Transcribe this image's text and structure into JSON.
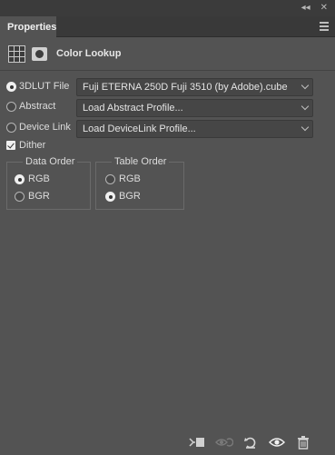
{
  "window": {
    "collapse_glyph": "◂◂",
    "close_glyph": "✕"
  },
  "panel": {
    "tab_label": "Properties",
    "adjustment_title": "Color Lookup"
  },
  "lookup": {
    "options": [
      {
        "label": "3DLUT File",
        "selected": true,
        "value": "Fuji ETERNA 250D Fuji 3510 (by Adobe).cube"
      },
      {
        "label": "Abstract",
        "selected": false,
        "value": "Load Abstract Profile..."
      },
      {
        "label": "Device Link",
        "selected": false,
        "value": "Load DeviceLink Profile..."
      }
    ],
    "dither": {
      "label": "Dither",
      "checked": true
    }
  },
  "data_order": {
    "title": "Data Order",
    "options": [
      {
        "label": "RGB",
        "selected": true
      },
      {
        "label": "BGR",
        "selected": false
      }
    ]
  },
  "table_order": {
    "title": "Table Order",
    "options": [
      {
        "label": "RGB",
        "selected": false
      },
      {
        "label": "BGR",
        "selected": true
      }
    ]
  },
  "footer": {
    "icons": [
      "clip-to-layer-icon",
      "view-previous-state-icon",
      "reset-adjustment-icon",
      "visibility-eye-icon",
      "delete-trash-icon"
    ]
  },
  "colors": {
    "panel_bg": "#535353",
    "tab_bar_bg": "#393939",
    "dropdown_bg": "#464646",
    "text": "#dcdcdc"
  }
}
